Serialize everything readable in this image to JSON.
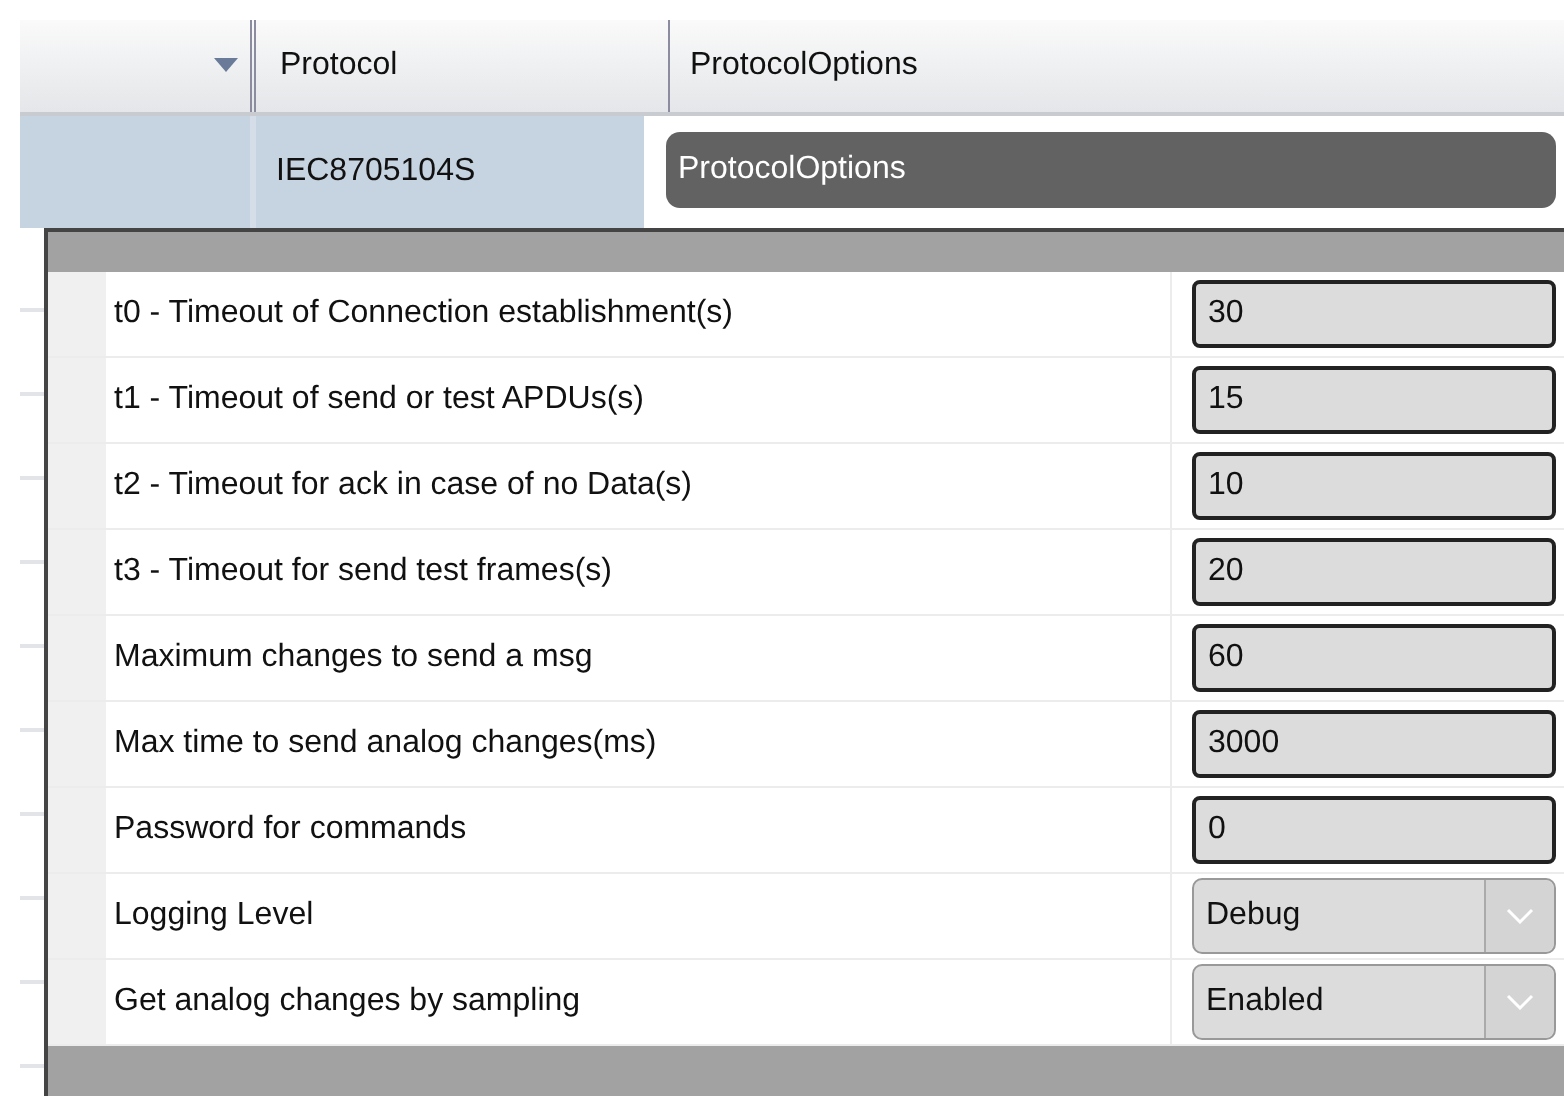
{
  "grid": {
    "columns": [
      {
        "label": "Protocol"
      },
      {
        "label": "ProtocolOptions"
      }
    ],
    "row": {
      "protocol": "IEC8705104S",
      "options": "ProtocolOptions"
    }
  },
  "options_popup": {
    "rows": [
      {
        "label": "t0 - Timeout of Connection establishment(s)",
        "kind": "text",
        "value": "30"
      },
      {
        "label": "t1 - Timeout of send or test APDUs(s)",
        "kind": "text",
        "value": "15"
      },
      {
        "label": "t2 - Timeout for ack in case of no Data(s)",
        "kind": "text",
        "value": "10"
      },
      {
        "label": "t3 - Timeout for send test frames(s)",
        "kind": "text",
        "value": "20"
      },
      {
        "label": "Maximum changes to send a msg",
        "kind": "text",
        "value": "60"
      },
      {
        "label": "Max time to send analog changes(ms)",
        "kind": "text",
        "value": "3000"
      },
      {
        "label": "Password for commands",
        "kind": "text",
        "value": "0"
      },
      {
        "label": "Logging Level",
        "kind": "combo",
        "value": "Debug"
      },
      {
        "label": "Get analog changes by sampling",
        "kind": "combo",
        "value": "Enabled"
      }
    ]
  }
}
